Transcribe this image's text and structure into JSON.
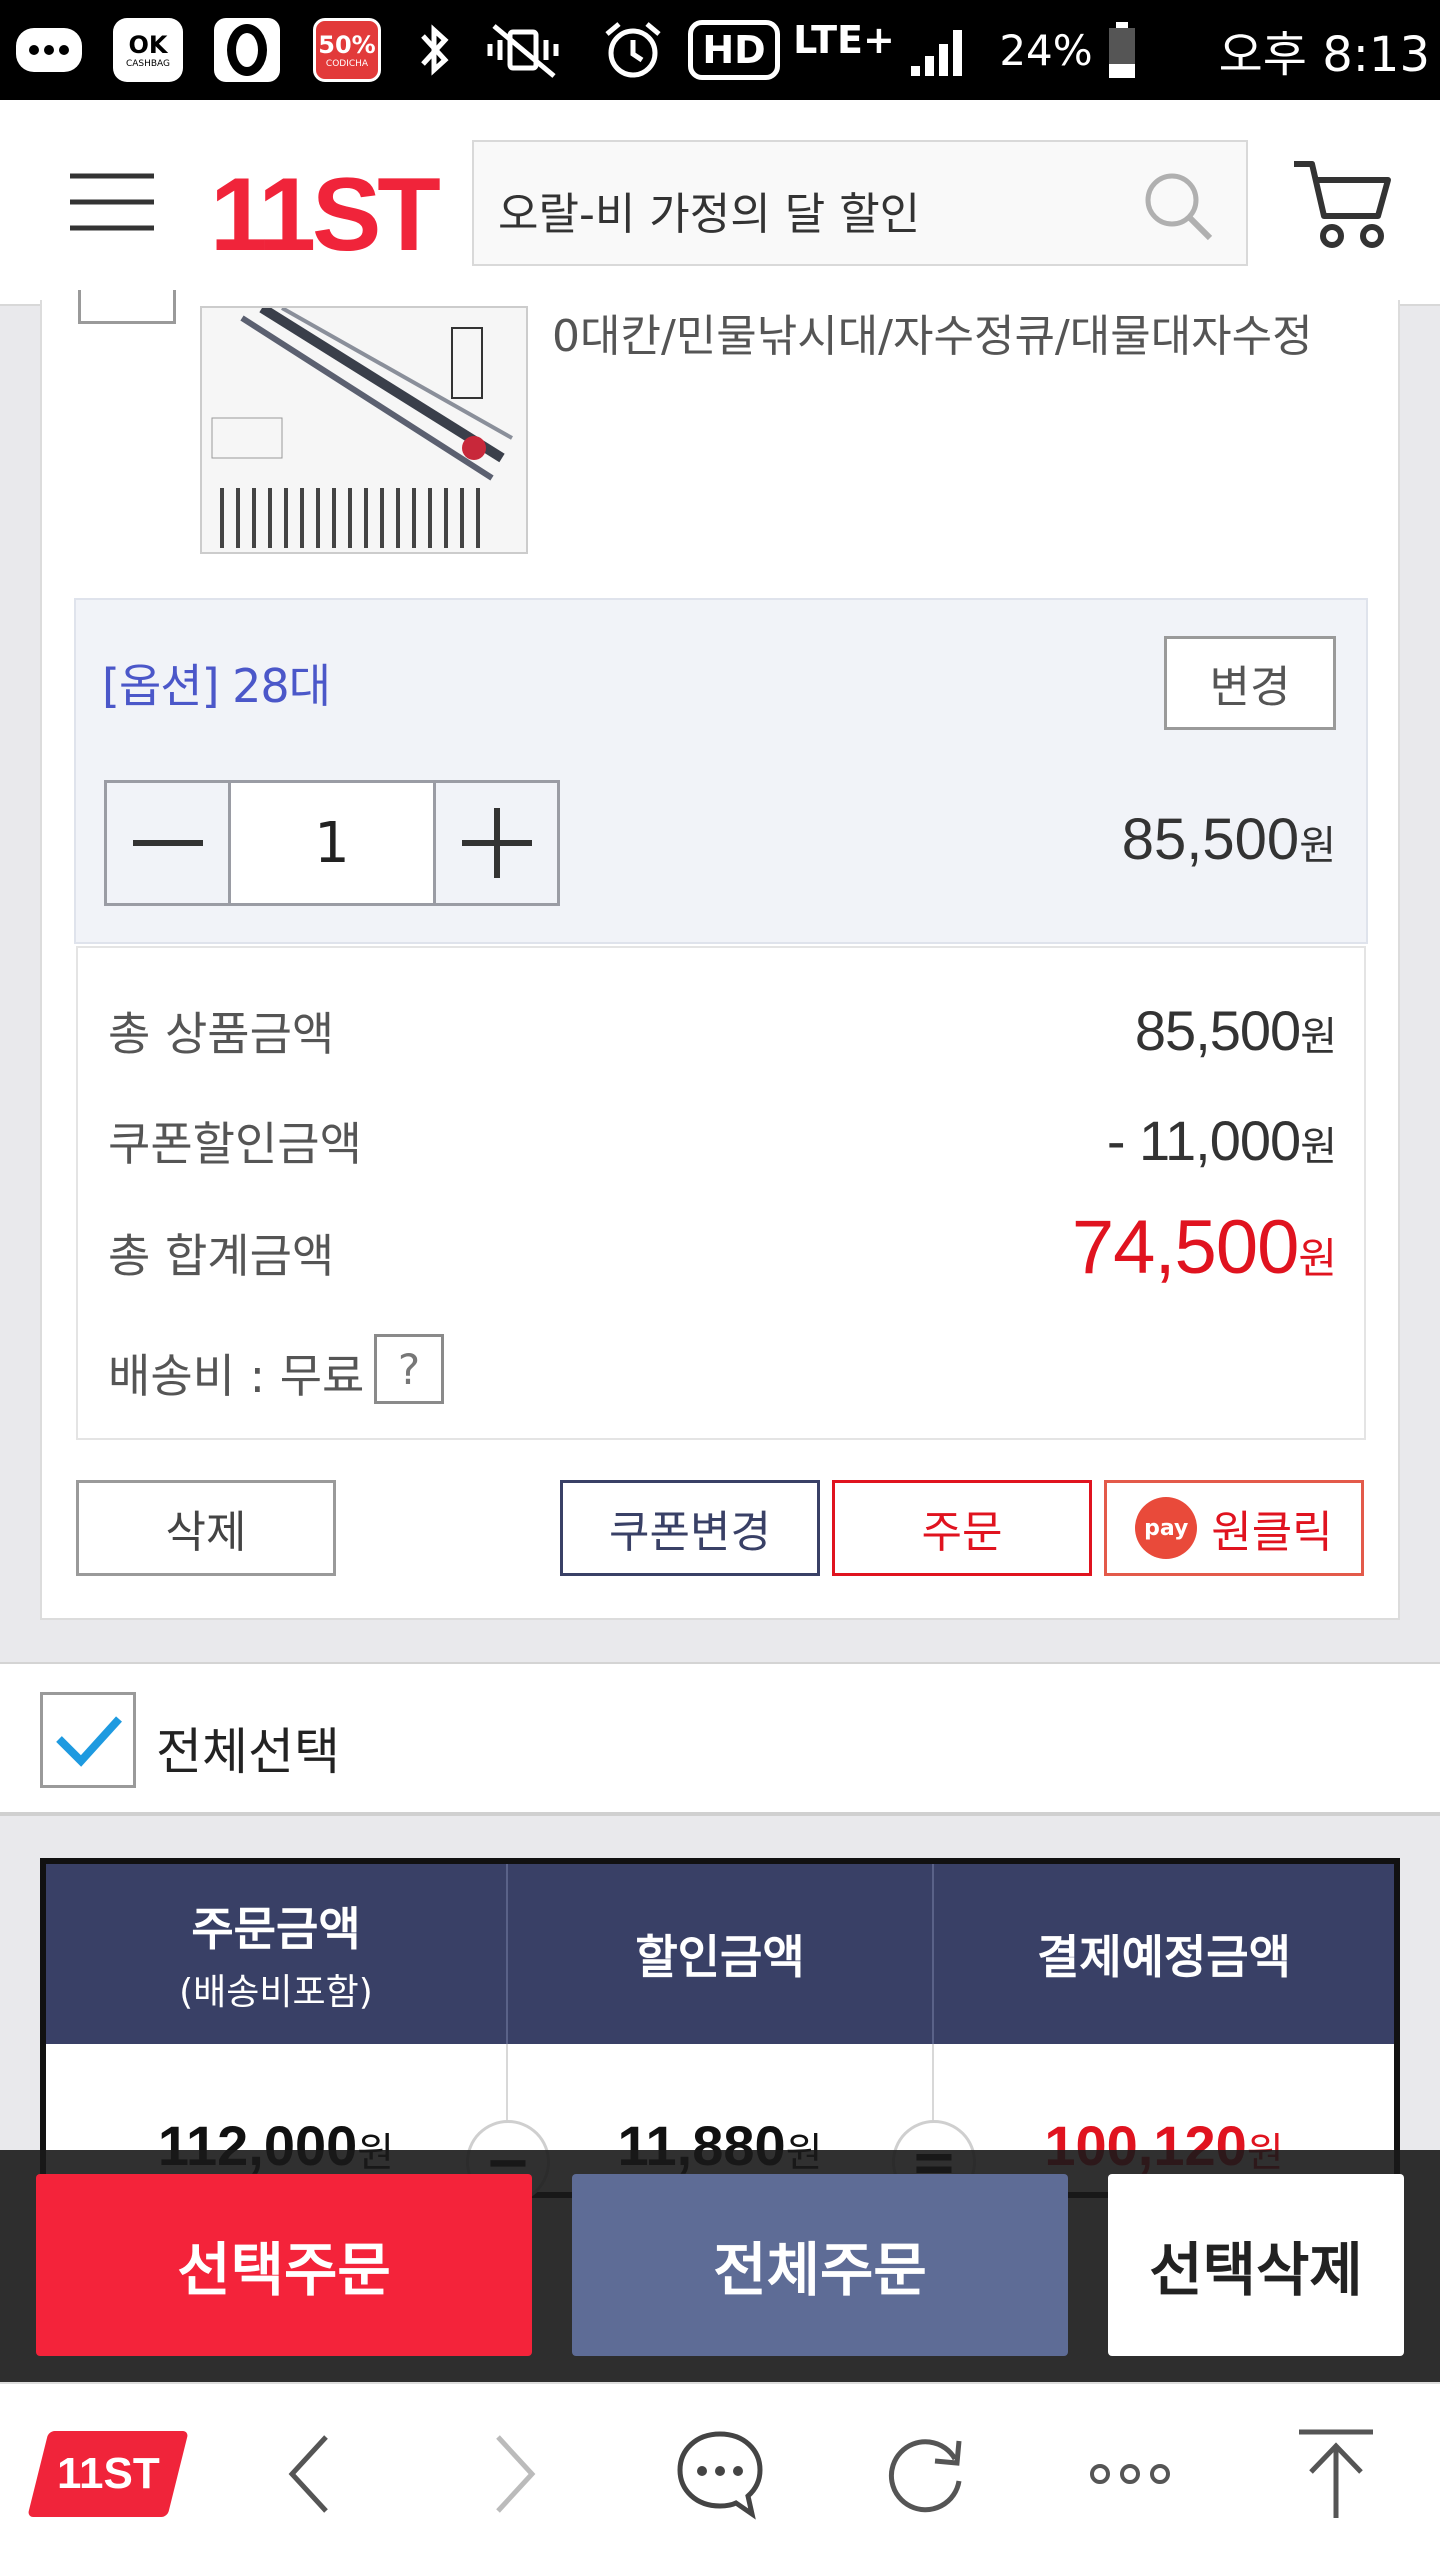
{
  "status_bar": {
    "badge_ok": "OK",
    "badge_ok_sub": "CASHBAG",
    "badge_percent": "50%",
    "badge_percent_sub": "CODICHA",
    "hd_label": "HD",
    "network_label": "LTE+",
    "battery": "24%",
    "time": "오후 8:13"
  },
  "header": {
    "logo": "11ST",
    "search_value": "오랄-비 가정의 달 할인"
  },
  "product": {
    "title_fragment": "0대칸/민물낚시대/자수정큐/대물대자수정",
    "option_label": "[옵션] 28대",
    "change_button": "변경",
    "quantity": "1",
    "option_price": "85,500",
    "won": "원"
  },
  "summary": {
    "total_product_label": "총 상품금액",
    "total_product_value": "85,500",
    "coupon_label": "쿠폰할인금액",
    "coupon_value": "- 11,000",
    "grand_total_label": "총 합계금액",
    "grand_total_value": "74,500",
    "shipping_label": "배송비 : 무료",
    "help_glyph": "?"
  },
  "card_buttons": {
    "delete": "삭제",
    "coupon_change": "쿠폰변경",
    "order": "주문",
    "pay_badge": "pay",
    "one_click": "원클릭"
  },
  "select_all": {
    "label": "전체선택",
    "checked": true
  },
  "totals": {
    "headers": [
      {
        "main": "주문금액",
        "sub": "(배송비포함)"
      },
      {
        "main": "할인금액",
        "sub": ""
      },
      {
        "main": "결제예정금액",
        "sub": ""
      }
    ],
    "order_amount": "112,000",
    "discount_amount": "11,880",
    "payment_amount": "100,120",
    "minus_sign": "−",
    "equals_sign": "=",
    "won": "원"
  },
  "action_bar": {
    "order_selected": "선택주문",
    "order_all": "전체주문",
    "delete_selected": "선택삭제"
  },
  "navbar": {
    "logo": "11ST"
  },
  "colors": {
    "brand_red": "#f0243a",
    "price_red": "#e0131f",
    "navy": "#394066",
    "option_blue": "#4b57c9",
    "order_all": "#5e6c96"
  }
}
